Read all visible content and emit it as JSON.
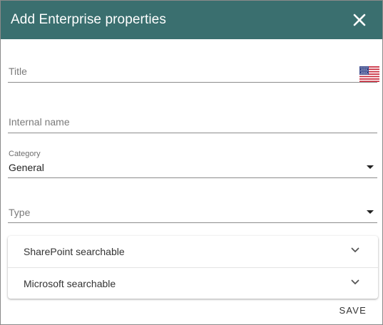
{
  "dialog": {
    "title": "Add Enterprise properties",
    "close_icon": "close-icon"
  },
  "form": {
    "title_field": {
      "placeholder": "Title",
      "value": "",
      "language_icon": "us-flag-icon"
    },
    "internal_name_field": {
      "placeholder": "Internal name",
      "value": ""
    },
    "category_field": {
      "label": "Category",
      "value": "General"
    },
    "type_field": {
      "placeholder": "Type",
      "value": ""
    }
  },
  "accordion": {
    "items": [
      {
        "label": "SharePoint searchable"
      },
      {
        "label": "Microsoft searchable"
      }
    ]
  },
  "actions": {
    "save_label": "SAVE"
  },
  "colors": {
    "header_bg": "#3a6f6f",
    "header_text": "#ffffff"
  }
}
